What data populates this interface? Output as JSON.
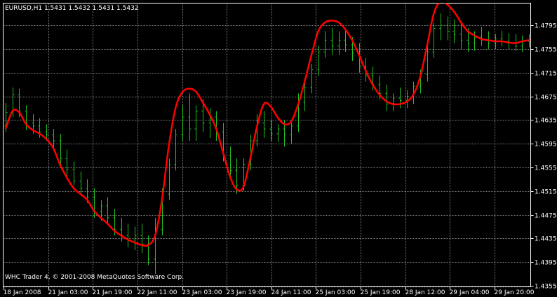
{
  "header": {
    "symbol_info": "EURUSD,H1  1.5431 1.5432 1.5431 1.5432"
  },
  "footer": {
    "copyright": "WHC Trader 4, © 2001-2008 MetaQuotes Software Corp."
  },
  "colors": {
    "background": "#000000",
    "grid": "#7f7f7f",
    "bars": "#22c022",
    "indicator": "#ff0000",
    "text": "#ffffff"
  },
  "chart_data": {
    "type": "line",
    "title": "EURUSD,H1  1.5431 1.5432 1.5431 1.5432",
    "grid": true,
    "grid_style": "dotted",
    "ylim": [
      1.4355,
      1.4825
    ],
    "y_ticks": [
      "1.4795",
      "1.4755",
      "1.4715",
      "1.4675",
      "1.4635",
      "1.4595",
      "1.4555",
      "1.4515",
      "1.4475",
      "1.4435",
      "1.4395",
      "1.4355"
    ],
    "x_ticks": [
      "18 Jan 2008",
      "21 Jan 03:00",
      "21 Jan 19:00",
      "22 Jan 11:00",
      "23 Jan 03:00",
      "23 Jan 19:00",
      "24 Jan 11:00",
      "25 Jan 03:00",
      "25 Jan 19:00",
      "28 Jan 12:00",
      "29 Jan 04:00",
      "29 Jan 20:00"
    ],
    "x_range": [
      "18 Jan 2008",
      "30 Jan 2008"
    ],
    "series": [
      {
        "kind": "ohlc-bars",
        "color": "#22c022",
        "values": [
          [
            1.4625,
            1.4664,
            1.4615,
            1.4648
          ],
          [
            1.4648,
            1.469,
            1.464,
            1.4678
          ],
          [
            1.4678,
            1.4688,
            1.464,
            1.465
          ],
          [
            1.465,
            1.466,
            1.4618,
            1.463
          ],
          [
            1.463,
            1.4645,
            1.4612,
            1.4625
          ],
          [
            1.4625,
            1.4638,
            1.4605,
            1.4615
          ],
          [
            1.4615,
            1.4628,
            1.46,
            1.461
          ],
          [
            1.461,
            1.462,
            1.4588,
            1.46
          ],
          [
            1.46,
            1.4612,
            1.456,
            1.457
          ],
          [
            1.457,
            1.4585,
            1.454,
            1.4552
          ],
          [
            1.4552,
            1.4565,
            1.4525,
            1.4532
          ],
          [
            1.4532,
            1.4548,
            1.451,
            1.452
          ],
          [
            1.452,
            1.4535,
            1.4495,
            1.4505
          ],
          [
            1.4505,
            1.452,
            1.447,
            1.448
          ],
          [
            1.448,
            1.45,
            1.4465,
            1.449
          ],
          [
            1.449,
            1.4505,
            1.446,
            1.447
          ],
          [
            1.447,
            1.4485,
            1.444,
            1.445
          ],
          [
            1.445,
            1.447,
            1.443,
            1.444
          ],
          [
            1.444,
            1.446,
            1.442,
            1.4432
          ],
          [
            1.4432,
            1.4455,
            1.4415,
            1.444
          ],
          [
            1.444,
            1.446,
            1.441,
            1.4425
          ],
          [
            1.4425,
            1.444,
            1.439,
            1.44
          ],
          [
            1.44,
            1.447,
            1.4375,
            1.445
          ],
          [
            1.445,
            1.452,
            1.444,
            1.451
          ],
          [
            1.451,
            1.457,
            1.45,
            1.456
          ],
          [
            1.456,
            1.462,
            1.455,
            1.461
          ],
          [
            1.461,
            1.466,
            1.46,
            1.464
          ],
          [
            1.464,
            1.468,
            1.46,
            1.462
          ],
          [
            1.462,
            1.466,
            1.46,
            1.465
          ],
          [
            1.465,
            1.467,
            1.4615,
            1.463
          ],
          [
            1.463,
            1.4655,
            1.4605,
            1.464
          ],
          [
            1.464,
            1.465,
            1.46,
            1.4615
          ],
          [
            1.4615,
            1.463,
            1.4565,
            1.4575
          ],
          [
            1.4575,
            1.459,
            1.454,
            1.455
          ],
          [
            1.455,
            1.457,
            1.451,
            1.4525
          ],
          [
            1.4525,
            1.457,
            1.4515,
            1.456
          ],
          [
            1.456,
            1.461,
            1.455,
            1.46
          ],
          [
            1.46,
            1.4645,
            1.459,
            1.463
          ],
          [
            1.463,
            1.465,
            1.4605,
            1.462
          ],
          [
            1.462,
            1.4635,
            1.46,
            1.4612
          ],
          [
            1.4612,
            1.4628,
            1.4598,
            1.462
          ],
          [
            1.462,
            1.4635,
            1.459,
            1.461
          ],
          [
            1.461,
            1.463,
            1.4595,
            1.4625
          ],
          [
            1.4625,
            1.468,
            1.4615,
            1.4665
          ],
          [
            1.4665,
            1.47,
            1.465,
            1.469
          ],
          [
            1.469,
            1.473,
            1.468,
            1.472
          ],
          [
            1.472,
            1.476,
            1.471,
            1.475
          ],
          [
            1.475,
            1.4785,
            1.474,
            1.477
          ],
          [
            1.477,
            1.479,
            1.4745,
            1.476
          ],
          [
            1.476,
            1.4785,
            1.4745,
            1.477
          ],
          [
            1.477,
            1.479,
            1.475,
            1.4762
          ],
          [
            1.4762,
            1.4775,
            1.4735,
            1.4748
          ],
          [
            1.4748,
            1.4765,
            1.4715,
            1.4725
          ],
          [
            1.4725,
            1.474,
            1.47,
            1.471
          ],
          [
            1.471,
            1.4725,
            1.4685,
            1.4695
          ],
          [
            1.4695,
            1.471,
            1.467,
            1.468
          ],
          [
            1.468,
            1.4695,
            1.465,
            1.4662
          ],
          [
            1.4662,
            1.468,
            1.465,
            1.4672
          ],
          [
            1.4672,
            1.469,
            1.4655,
            1.4668
          ],
          [
            1.4668,
            1.4685,
            1.4655,
            1.4675
          ],
          [
            1.4675,
            1.47,
            1.4662,
            1.4692
          ],
          [
            1.4692,
            1.472,
            1.468,
            1.4712
          ],
          [
            1.4712,
            1.476,
            1.47,
            1.475
          ],
          [
            1.475,
            1.48,
            1.474,
            1.479
          ],
          [
            1.479,
            1.4815,
            1.477,
            1.4795
          ],
          [
            1.4795,
            1.481,
            1.477,
            1.4785
          ],
          [
            1.4785,
            1.4805,
            1.4765,
            1.478
          ],
          [
            1.478,
            1.4798,
            1.4755,
            1.477
          ],
          [
            1.477,
            1.479,
            1.475,
            1.4765
          ],
          [
            1.4765,
            1.4785,
            1.4752,
            1.4775
          ],
          [
            1.4775,
            1.4792,
            1.476,
            1.477
          ],
          [
            1.477,
            1.4785,
            1.4755,
            1.4765
          ],
          [
            1.4765,
            1.478,
            1.4755,
            1.4772
          ],
          [
            1.4772,
            1.4786,
            1.476,
            1.4768
          ],
          [
            1.4768,
            1.4782,
            1.4755,
            1.4765
          ],
          [
            1.4765,
            1.478,
            1.4752,
            1.476
          ],
          [
            1.476,
            1.4778,
            1.475,
            1.4768
          ],
          [
            1.4768,
            1.478,
            1.4758,
            1.4765
          ]
        ]
      },
      {
        "kind": "moving-average",
        "color": "#ff0000",
        "values": [
          1.462,
          1.465,
          1.4648,
          1.4628,
          1.4618,
          1.4612,
          1.4603,
          1.4588,
          1.456,
          1.4538,
          1.452,
          1.451,
          1.45,
          1.4482,
          1.447,
          1.446,
          1.4448,
          1.444,
          1.4433,
          1.4428,
          1.4424,
          1.4424,
          1.444,
          1.45,
          1.459,
          1.4655,
          1.4682,
          1.4688,
          1.4683,
          1.4665,
          1.4645,
          1.462,
          1.458,
          1.454,
          1.4518,
          1.4522,
          1.457,
          1.4625,
          1.4662,
          1.4658,
          1.464,
          1.4628,
          1.4632,
          1.466,
          1.47,
          1.4745,
          1.4785,
          1.48,
          1.4803,
          1.48,
          1.4788,
          1.477,
          1.4745,
          1.4718,
          1.4695,
          1.4678,
          1.4667,
          1.4662,
          1.4662,
          1.4666,
          1.4678,
          1.4708,
          1.476,
          1.4815,
          1.4835,
          1.483,
          1.4818,
          1.48,
          1.4785,
          1.4778,
          1.4772,
          1.477,
          1.4768,
          1.4768,
          1.4766,
          1.4765,
          1.4768,
          1.477
        ]
      }
    ]
  }
}
